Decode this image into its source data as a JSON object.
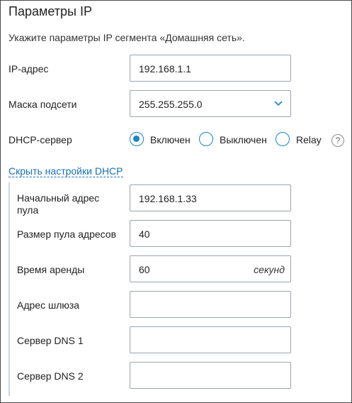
{
  "header": {
    "title": "Параметры IP",
    "description": "Укажите параметры IP сегмента «Домашняя сеть»."
  },
  "ip": {
    "label": "IP-адрес",
    "value": "192.168.1.1"
  },
  "mask": {
    "label": "Маска подсети",
    "value": "255.255.255.0"
  },
  "dhcp": {
    "label": "DHCP-сервер",
    "options": [
      {
        "label": "Включен",
        "selected": true
      },
      {
        "label": "Выключен",
        "selected": false
      },
      {
        "label": "Relay",
        "selected": false
      }
    ],
    "help": "?",
    "toggle_link": "Скрыть настройки DHCP",
    "pool_start": {
      "label_line1": "Начальный адрес",
      "label_line2": "пула",
      "value": "192.168.1.33"
    },
    "pool_size": {
      "label": "Размер пула адресов",
      "value": "40"
    },
    "lease": {
      "label": "Время аренды",
      "value": "60",
      "unit": "секунд"
    },
    "gateway": {
      "label": "Адрес шлюза",
      "value": ""
    },
    "dns1": {
      "label": "Сервер DNS 1",
      "value": ""
    },
    "dns2": {
      "label": "Сервер DNS 2",
      "value": ""
    }
  },
  "colors": {
    "accent": "#1a84c9",
    "link": "#1a6fb3",
    "border": "#9aa4ad"
  }
}
